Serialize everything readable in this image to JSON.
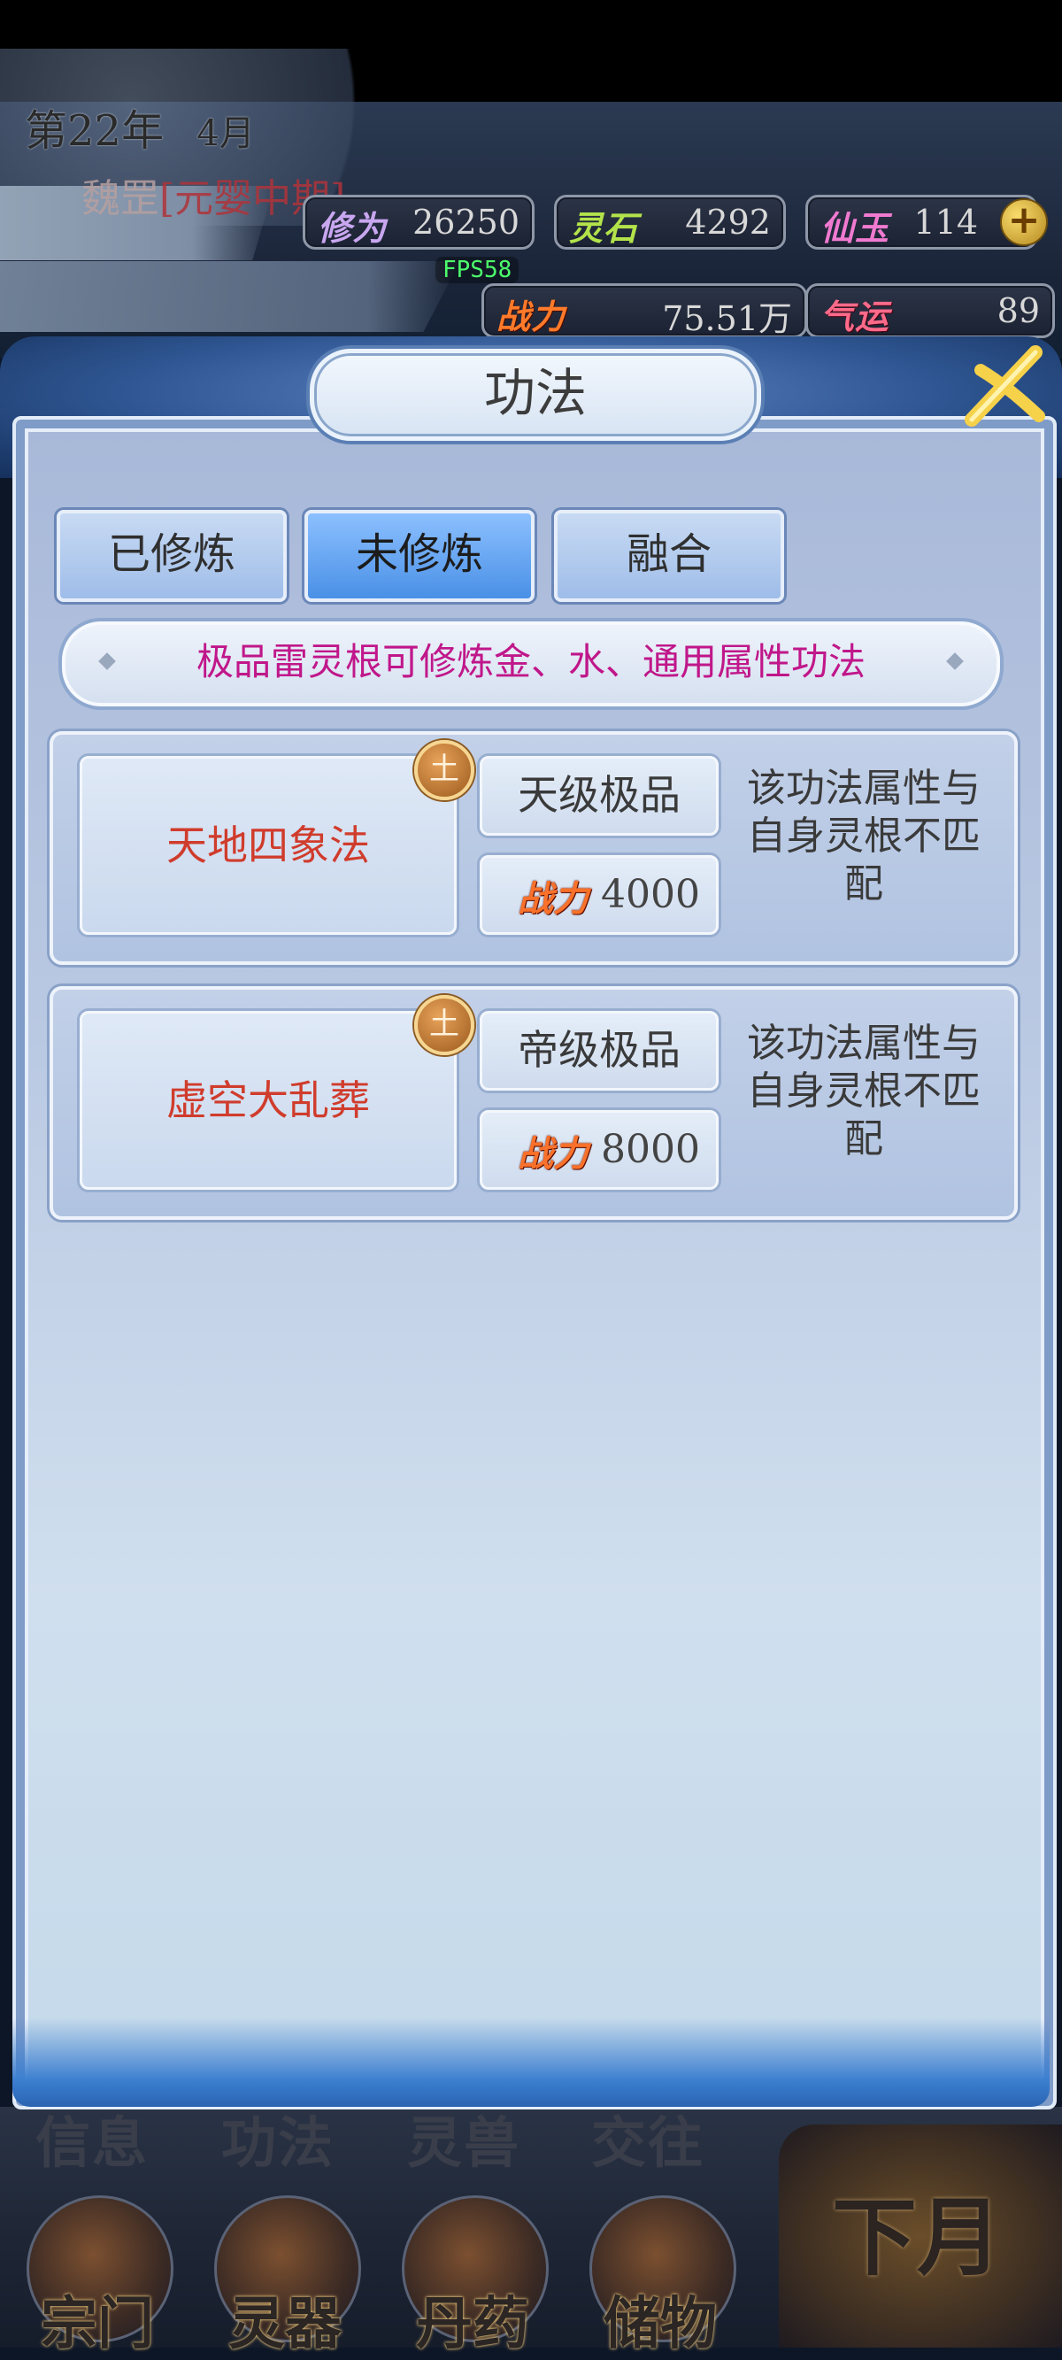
{
  "status": {
    "year": "第22年",
    "month": "4月",
    "player_name": "魏罡",
    "stage": "[元婴中期]",
    "fps": "FPS58"
  },
  "resources": [
    {
      "label": "修为",
      "value": "26250",
      "color": "#c9a7f0"
    },
    {
      "label": "灵石",
      "value": "4292",
      "color": "#b3e34a"
    },
    {
      "label": "仙玉",
      "value": "114",
      "color": "#f07ad0"
    },
    {
      "label": "战力",
      "value": "75.51万",
      "color": "#ff7a2a"
    },
    {
      "label": "气运",
      "value": "89",
      "color": "#ff6a8a"
    }
  ],
  "panel": {
    "title": "功法",
    "tabs": [
      {
        "label": "已修炼",
        "active": false
      },
      {
        "label": "未修炼",
        "active": true
      },
      {
        "label": "融合",
        "active": false
      }
    ],
    "banner": "极品雷灵根可修炼金、水、通用属性功法",
    "techniques": [
      {
        "name": "天地四象法",
        "element": "土",
        "grade": "天级极品",
        "power_label": "战力",
        "power": "4000",
        "note": "该功法属性与自身灵根不匹配"
      },
      {
        "name": "虚空大乱葬",
        "element": "土",
        "grade": "帝级极品",
        "power_label": "战力",
        "power": "8000",
        "note": "该功法属性与自身灵根不匹配"
      }
    ]
  },
  "bottom_nav": {
    "top_row": [
      "信息",
      "功法",
      "灵兽",
      "交往"
    ],
    "buttons": [
      "宗门",
      "灵器",
      "丹药",
      "储物"
    ],
    "next_month": "下月"
  }
}
